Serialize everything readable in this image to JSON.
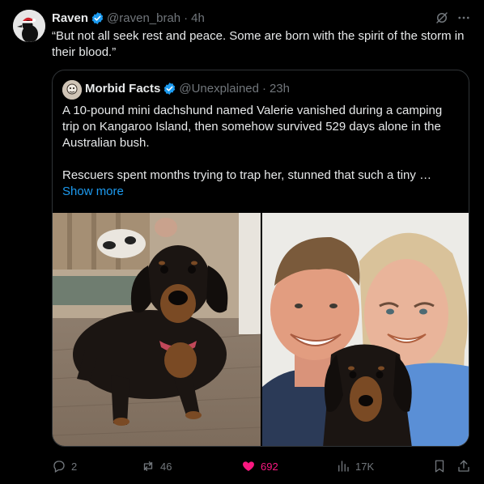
{
  "tweet": {
    "author_name": "Raven",
    "handle": "@raven_brah",
    "separator": "·",
    "time": "4h",
    "text": "“But not all seek rest and peace.  Some are born with the spirit of the storm in their blood.”"
  },
  "quote": {
    "author_name": "Morbid Facts",
    "handle": "@Unexplained",
    "separator": "·",
    "time": "23h",
    "paragraph1": "A 10-pound mini dachshund named Valerie vanished during a camping trip on Kangaroo Island, then somehow survived 529 days alone in the Australian bush.",
    "paragraph2": "Rescuers spent months trying to trap her, stunned that such a tiny …",
    "show_more": "Show more"
  },
  "actions": {
    "replies": "2",
    "reposts": "46",
    "likes": "692",
    "views": "17K"
  },
  "colors": {
    "background": "#000000",
    "text": "#e7e9ea",
    "muted": "#71767b",
    "accent": "#1d9bf0",
    "like": "#f91880",
    "border": "#2f3336"
  },
  "icons": [
    "verified-badge-icon",
    "grok-icon",
    "more-icon",
    "reply-icon",
    "repost-icon",
    "heart-icon",
    "views-icon",
    "bookmark-icon",
    "share-icon"
  ]
}
